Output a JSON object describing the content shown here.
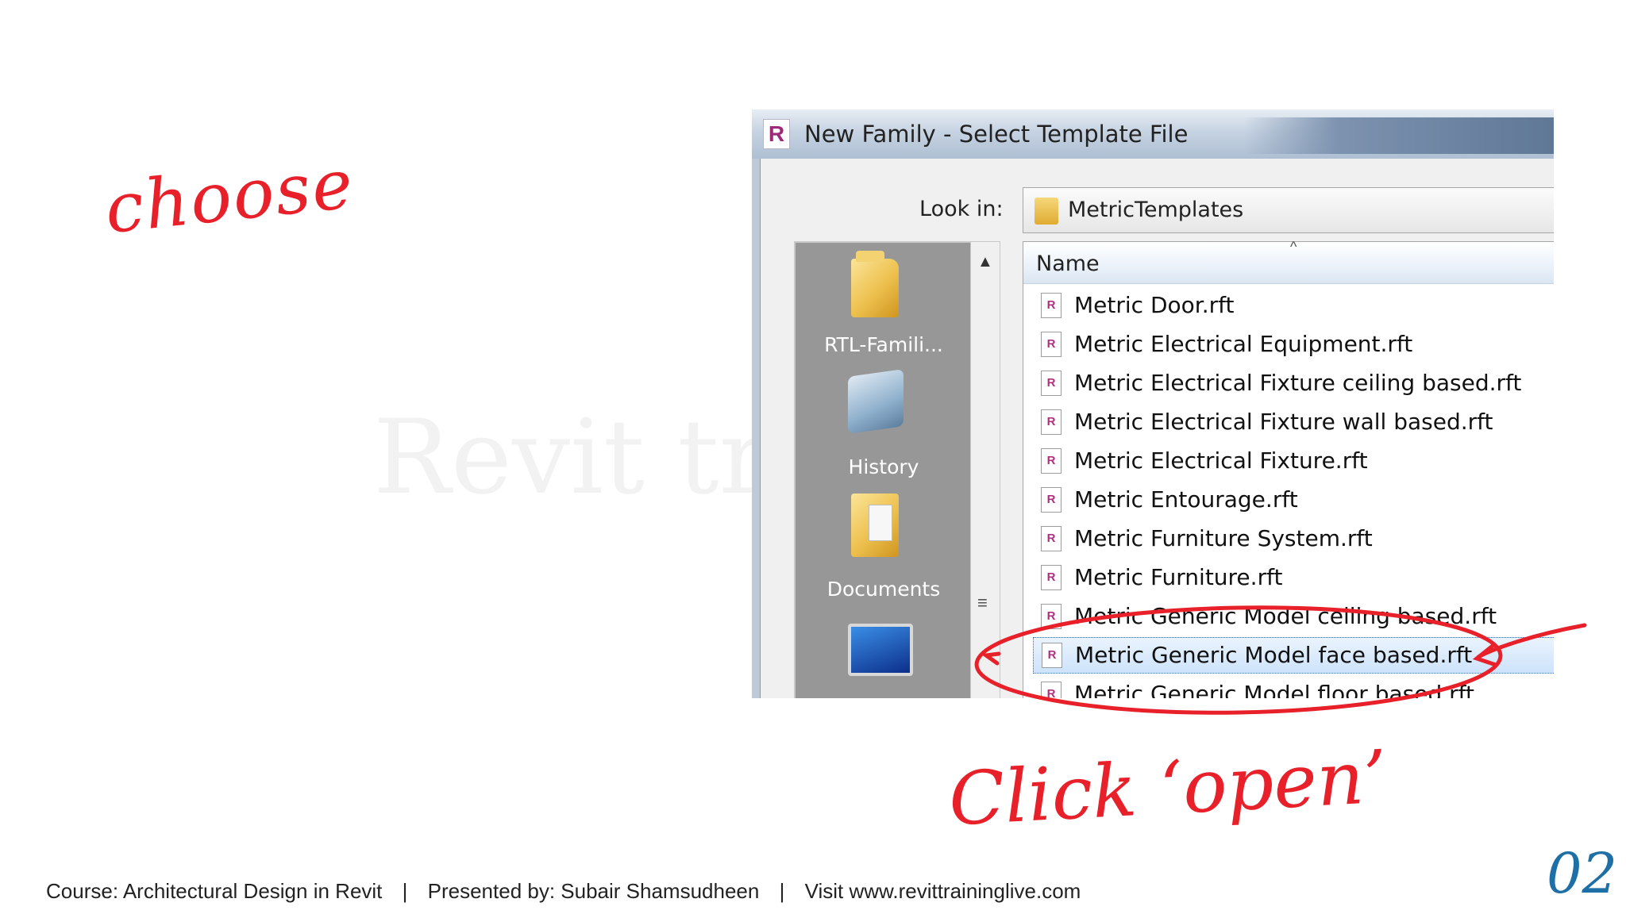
{
  "annotations": {
    "choose": "choose",
    "click_open": "Click ‘open’",
    "slide_number": "02"
  },
  "dialog": {
    "title": "New Family - Select Template File",
    "title_icon": "R",
    "look_in_label": "Look in:",
    "look_in_value": "MetricTemplates",
    "places": [
      {
        "label": "RTL-Famili...",
        "icon": "folder-icon"
      },
      {
        "label": "History",
        "icon": "history-icon"
      },
      {
        "label": "Documents",
        "icon": "documents-icon"
      },
      {
        "label": "",
        "icon": "computer-icon"
      }
    ],
    "list_header": "Name",
    "files": [
      "Metric Door.rft",
      "Metric Electrical Equipment.rft",
      "Metric Electrical Fixture ceiling based.rft",
      "Metric Electrical Fixture wall based.rft",
      "Metric Electrical Fixture.rft",
      "Metric Entourage.rft",
      "Metric Furniture System.rft",
      "Metric Furniture.rft",
      "Metric Generic Model ceiling based.rft",
      "Metric Generic Model face based.rft",
      "Metric Generic Model floor based.rft"
    ],
    "selected_file": "Metric Generic Model face based.rft"
  },
  "footer": {
    "course": "Course: Architectural Design in Revit",
    "presenter": "Presented by: Subair Shamsudheen",
    "visit": "Visit www.revittraininglive.com",
    "separator": "|"
  },
  "colors": {
    "annotation_red": "#e8202a",
    "slide_number_blue": "#1d6fa5",
    "selection_highlight": "#cde3fb"
  }
}
